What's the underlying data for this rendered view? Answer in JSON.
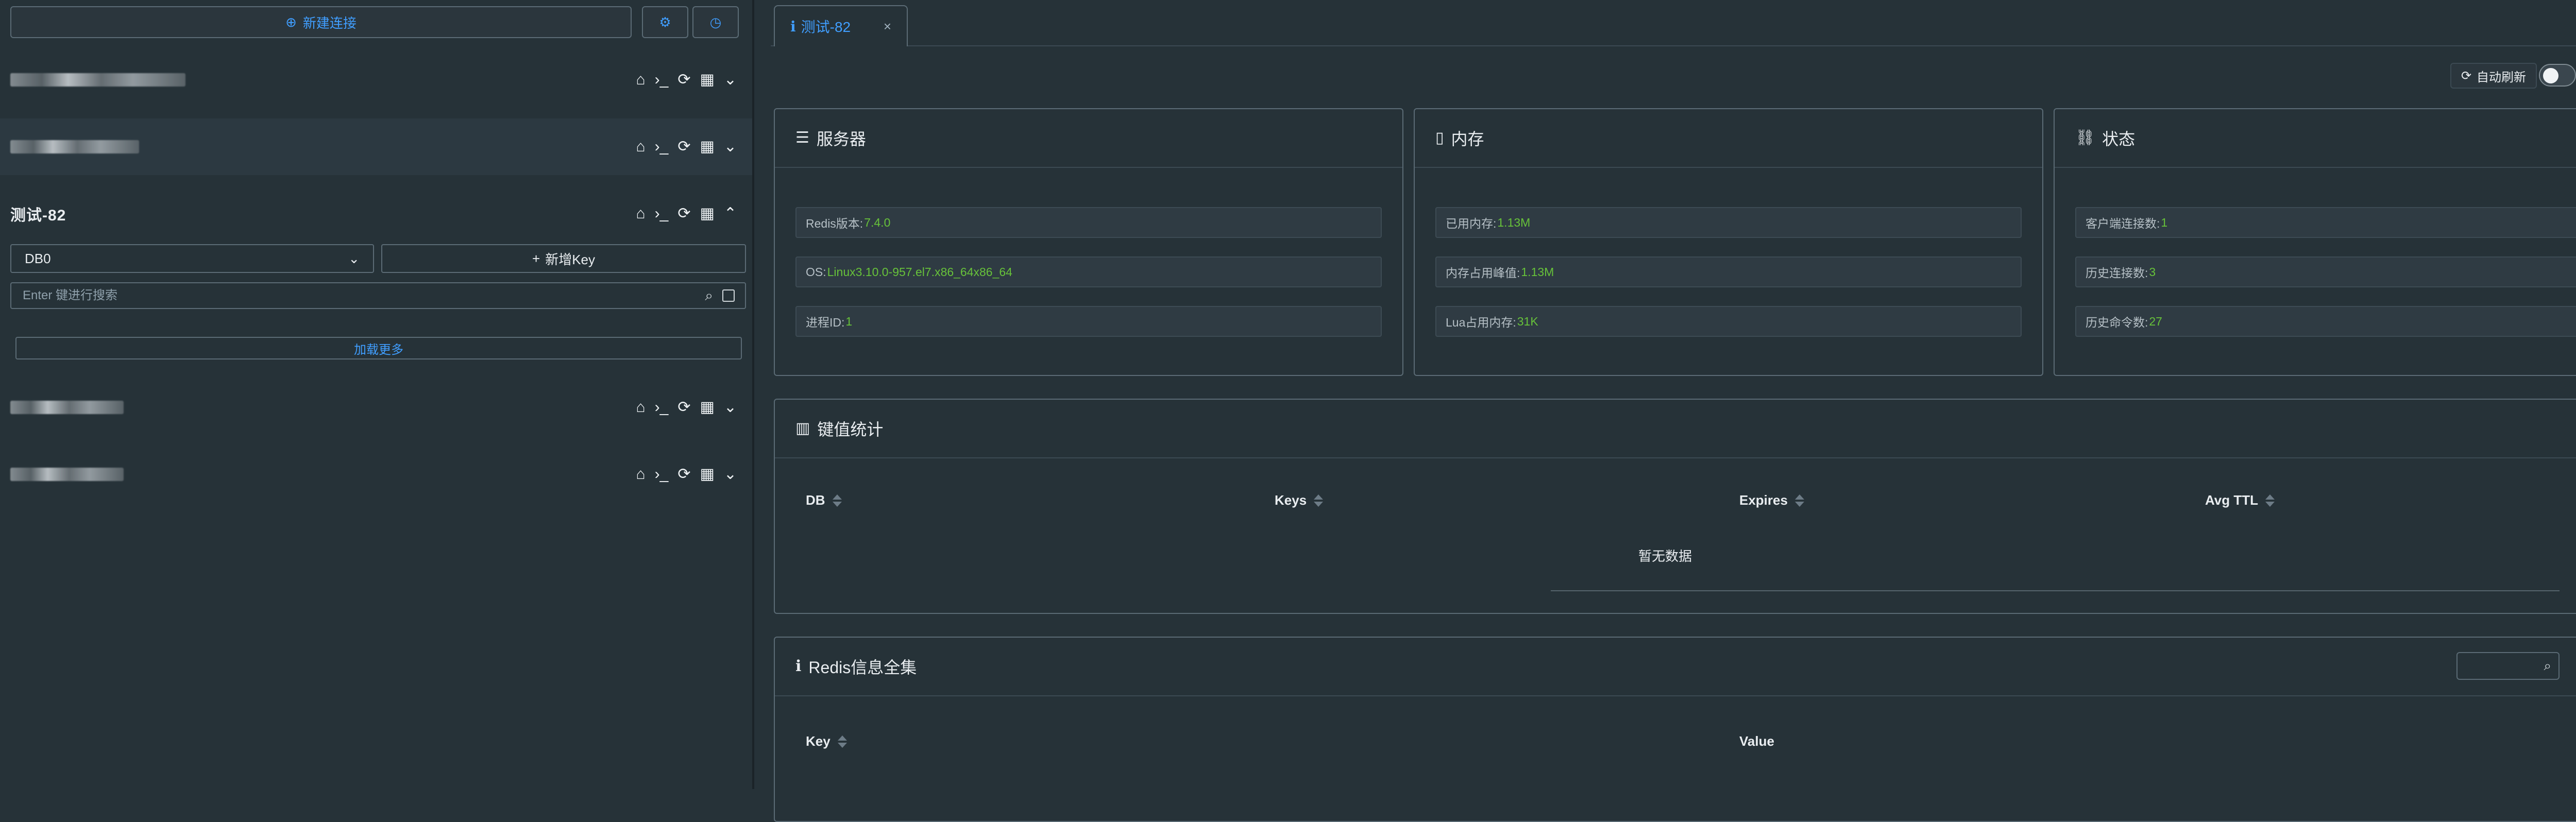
{
  "sidebar": {
    "new_connection_label": "新建连接",
    "settings_icon": "gear-icon",
    "history_icon": "history-icon",
    "connections": [
      {
        "name": "",
        "blurred": true
      },
      {
        "name": "",
        "blurred": true
      },
      {
        "name": "测试-82",
        "blurred": false,
        "expanded": true
      },
      {
        "name": "",
        "blurred": true
      },
      {
        "name": "",
        "blurred": true
      }
    ],
    "db_select_value": "DB0",
    "add_key_label": "新增Key",
    "search_placeholder": "Enter 键进行搜索",
    "load_more_label": "加载更多"
  },
  "main": {
    "tab_label": "测试-82",
    "auto_refresh_label": "自动刷新",
    "server_card": {
      "title": "服务器",
      "items": [
        {
          "label": "Redis版本:",
          "value": "7.4.0"
        },
        {
          "label": "OS:",
          "value": "Linux3.10.0-957.el7.x86_64x86_64"
        },
        {
          "label": "进程ID:",
          "value": "1"
        }
      ]
    },
    "memory_card": {
      "title": "内存",
      "items": [
        {
          "label": "已用内存:",
          "value": "1.13M"
        },
        {
          "label": "内存占用峰值:",
          "value": "1.13M"
        },
        {
          "label": "Lua占用内存:",
          "value": "31K"
        }
      ]
    },
    "status_card": {
      "title": "状态",
      "items": [
        {
          "label": "客户端连接数:",
          "value": "1"
        },
        {
          "label": "历史连接数:",
          "value": "3"
        },
        {
          "label": "历史命令数:",
          "value": "27"
        }
      ]
    },
    "key_stats": {
      "title": "键值统计",
      "columns": [
        "DB",
        "Keys",
        "Expires",
        "Avg TTL"
      ],
      "empty_text": "暂无数据"
    },
    "redis_info": {
      "title": "Redis信息全集",
      "columns": [
        "Key",
        "Value"
      ]
    }
  }
}
